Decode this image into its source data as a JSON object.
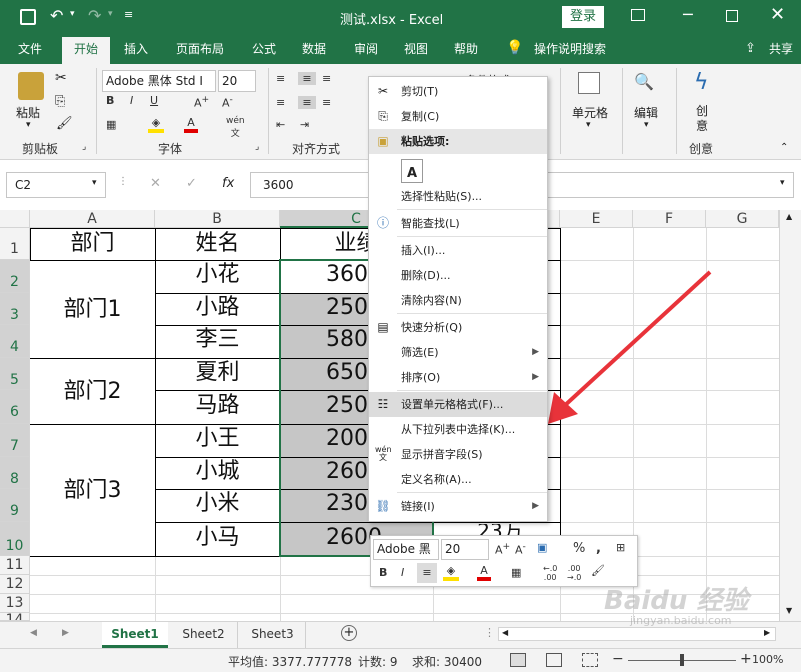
{
  "window": {
    "title": "测试.xlsx  -  Excel",
    "login_label": "登录"
  },
  "tabs": [
    "文件",
    "开始",
    "插入",
    "页面布局",
    "公式",
    "数据",
    "审阅",
    "视图",
    "帮助"
  ],
  "tell_me": "操作说明搜索",
  "share_label": "共享",
  "ribbon": {
    "paste_label": "粘贴",
    "font_name": "Adobe 黑体 Std I",
    "font_size": "20",
    "groups": {
      "clipboard": "剪贴板",
      "font": "字体",
      "alignment": "对齐方式",
      "cells": "单元格",
      "editing": "编辑",
      "creativity": "创意"
    },
    "cond_format_label": "条件格式",
    "cells_label": "单元格",
    "editing_label": "编辑",
    "create_label": "创意"
  },
  "formula_bar": {
    "name_box": "C2",
    "fx": "fx",
    "value": "3600"
  },
  "columns": [
    "A",
    "B",
    "C",
    "D",
    "E",
    "F",
    "G"
  ],
  "rows": [
    "1",
    "2",
    "3",
    "4",
    "5",
    "6",
    "7",
    "8",
    "9",
    "10",
    "11",
    "12",
    "13",
    "14"
  ],
  "headers": {
    "a": "部门",
    "b": "姓名",
    "c": "业绩"
  },
  "departments": [
    "部门1",
    "部门2",
    "部门3"
  ],
  "names": [
    "小花",
    "小路",
    "李三",
    "夏利",
    "马路",
    "小王",
    "小城",
    "小米",
    "小马"
  ],
  "sales": [
    "360",
    "250",
    "580",
    "650",
    "250",
    "200",
    "260",
    "230",
    "2600"
  ],
  "d_partial": "23万",
  "context_menu": {
    "items": [
      "剪切(T)",
      "复制(C)",
      "粘贴选项:",
      "选择性粘贴(S)...",
      "智能查找(L)",
      "插入(I)...",
      "删除(D)...",
      "清除内容(N)",
      "快速分析(Q)",
      "筛选(E)",
      "排序(O)",
      "设置单元格格式(F)...",
      "从下拉列表中选择(K)...",
      "显示拼音字段(S)",
      "定义名称(A)...",
      "链接(I)"
    ]
  },
  "mini_toolbar": {
    "font": "Adobe 黑",
    "size": "20"
  },
  "sheets": [
    "Sheet1",
    "Sheet2",
    "Sheet3"
  ],
  "status": {
    "average": "平均值: 3377.777778",
    "count": "计数: 9",
    "sum": "求和: 30400",
    "zoom": "100%"
  },
  "watermark": "Baidu 经验",
  "watermark_url": "jingyan.baidu.com",
  "colors": {
    "excel_green": "#217346",
    "selection_fill": "#c6c6c6",
    "arrow_red": "#e8333a"
  }
}
